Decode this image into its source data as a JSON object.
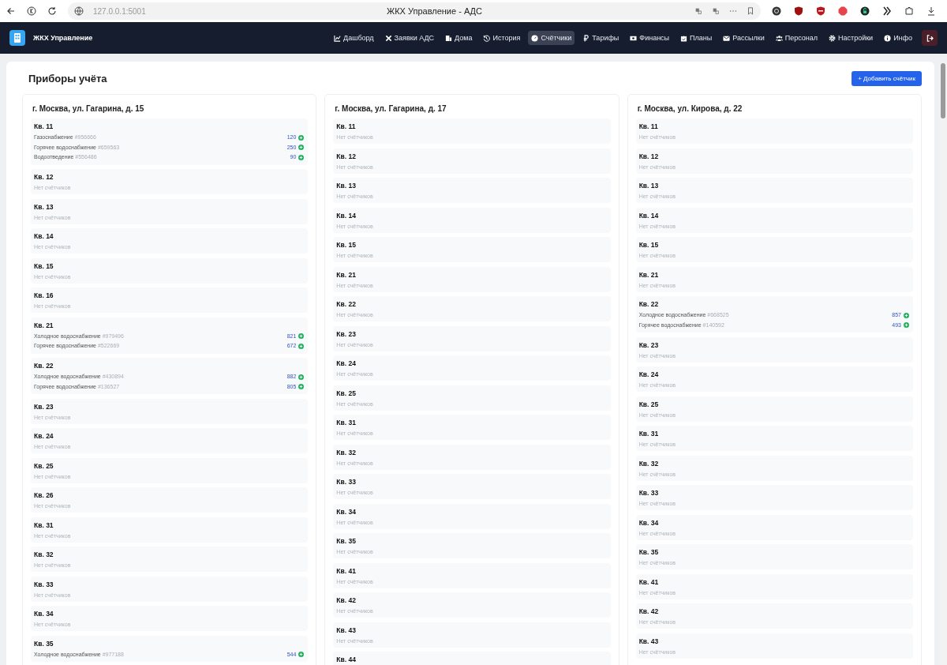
{
  "browser": {
    "url": "127.0.0.1:5001",
    "title": "ЖКХ Управление - АДС"
  },
  "app": {
    "brand": "ЖКХ Управление",
    "nav": [
      {
        "label": "Дашборд",
        "selected": false
      },
      {
        "label": "Заявки АДС",
        "selected": false
      },
      {
        "label": "Дома",
        "selected": false
      },
      {
        "label": "История",
        "selected": false
      },
      {
        "label": "Счётчики",
        "selected": true
      },
      {
        "label": "Тарифы",
        "selected": false
      },
      {
        "label": "Финансы",
        "selected": false
      },
      {
        "label": "Планы",
        "selected": false
      },
      {
        "label": "Рассылки",
        "selected": false
      },
      {
        "label": "Персонал",
        "selected": false
      },
      {
        "label": "Настройки",
        "selected": false
      },
      {
        "label": "Инфо",
        "selected": false
      }
    ]
  },
  "page": {
    "title": "Приборы учёта",
    "add_button": "+ Добавить счётчик"
  },
  "houses": [
    {
      "address": "г. Москва, ул. Гагарина, д. 15",
      "apartments": [
        {
          "name": "Кв. 11",
          "meters": [
            {
              "type": "Газоснабжение",
              "number": "#956666",
              "reading": "120"
            },
            {
              "type": "Горячее водоснабжение",
              "number": "#659563",
              "reading": "250"
            },
            {
              "type": "Водоотведение",
              "number": "#556486",
              "reading": "90"
            }
          ]
        },
        {
          "name": "Кв. 12",
          "note": "Нет счётчиков"
        },
        {
          "name": "Кв. 13",
          "note": "Нет счётчиков"
        },
        {
          "name": "Кв. 14",
          "note": "Нет счётчиков"
        },
        {
          "name": "Кв. 15",
          "note": "Нет счётчиков"
        },
        {
          "name": "Кв. 16",
          "note": "Нет счётчиков"
        },
        {
          "name": "Кв. 21",
          "meters": [
            {
              "type": "Холодное водоснабжение",
              "number": "#979496",
              "reading": "821"
            },
            {
              "type": "Горячее водоснабжение",
              "number": "#522669",
              "reading": "672"
            }
          ]
        },
        {
          "name": "Кв. 22",
          "meters": [
            {
              "type": "Холодное водоснабжение",
              "number": "#430894",
              "reading": "882"
            },
            {
              "type": "Горячее водоснабжение",
              "number": "#136527",
              "reading": "805"
            }
          ]
        },
        {
          "name": "Кв. 23",
          "note": "Нет счётчиков"
        },
        {
          "name": "Кв. 24",
          "note": "Нет счётчиков"
        },
        {
          "name": "Кв. 25",
          "note": "Нет счётчиков"
        },
        {
          "name": "Кв. 26",
          "note": "Нет счётчиков"
        },
        {
          "name": "Кв. 31",
          "note": "Нет счётчиков"
        },
        {
          "name": "Кв. 32",
          "note": "Нет счётчиков"
        },
        {
          "name": "Кв. 33",
          "note": "Нет счётчиков"
        },
        {
          "name": "Кв. 34",
          "note": "Нет счётчиков"
        },
        {
          "name": "Кв. 35",
          "meters": [
            {
              "type": "Холодное водоснабжение",
              "number": "#977188",
              "reading": "544"
            }
          ]
        }
      ]
    },
    {
      "address": "г. Москва, ул. Гагарина, д. 17",
      "apartments": [
        {
          "name": "Кв. 11",
          "note": "Нет счётчиков"
        },
        {
          "name": "Кв. 12",
          "note": "Нет счётчиков"
        },
        {
          "name": "Кв. 13",
          "note": "Нет счётчиков"
        },
        {
          "name": "Кв. 14",
          "note": "Нет счётчиков"
        },
        {
          "name": "Кв. 15",
          "note": "Нет счётчиков"
        },
        {
          "name": "Кв. 21",
          "note": "Нет счётчиков"
        },
        {
          "name": "Кв. 22",
          "note": "Нет счётчиков"
        },
        {
          "name": "Кв. 23",
          "note": "Нет счётчиков"
        },
        {
          "name": "Кв. 24",
          "note": "Нет счётчиков"
        },
        {
          "name": "Кв. 25",
          "note": "Нет счётчиков"
        },
        {
          "name": "Кв. 31",
          "note": "Нет счётчиков"
        },
        {
          "name": "Кв. 32",
          "note": "Нет счётчиков"
        },
        {
          "name": "Кв. 33",
          "note": "Нет счётчиков"
        },
        {
          "name": "Кв. 34",
          "note": "Нет счётчиков"
        },
        {
          "name": "Кв. 35",
          "note": "Нет счётчиков"
        },
        {
          "name": "Кв. 41",
          "note": "Нет счётчиков"
        },
        {
          "name": "Кв. 42",
          "note": "Нет счётчиков"
        },
        {
          "name": "Кв. 43",
          "note": "Нет счётчиков"
        },
        {
          "name": "Кв. 44"
        }
      ]
    },
    {
      "address": "г. Москва, ул. Кирова, д. 22",
      "apartments": [
        {
          "name": "Кв. 11",
          "note": "Нет счётчиков"
        },
        {
          "name": "Кв. 12",
          "note": "Нет счётчиков"
        },
        {
          "name": "Кв. 13",
          "note": "Нет счётчиков"
        },
        {
          "name": "Кв. 14",
          "note": "Нет счётчиков"
        },
        {
          "name": "Кв. 15",
          "note": "Нет счётчиков"
        },
        {
          "name": "Кв. 21",
          "note": "Нет счётчиков"
        },
        {
          "name": "Кв. 22",
          "meters": [
            {
              "type": "Холодное водоснабжение",
              "number": "#668525",
              "reading": "857"
            },
            {
              "type": "Горячее водоснабжение",
              "number": "#140592",
              "reading": "493"
            }
          ]
        },
        {
          "name": "Кв. 23",
          "note": "Нет счётчиков"
        },
        {
          "name": "Кв. 24",
          "note": "Нет счётчиков"
        },
        {
          "name": "Кв. 25",
          "note": "Нет счётчиков"
        },
        {
          "name": "Кв. 31",
          "note": "Нет счётчиков"
        },
        {
          "name": "Кв. 32",
          "note": "Нет счётчиков"
        },
        {
          "name": "Кв. 33",
          "note": "Нет счётчиков"
        },
        {
          "name": "Кв. 34",
          "note": "Нет счётчиков"
        },
        {
          "name": "Кв. 35",
          "note": "Нет счётчиков"
        },
        {
          "name": "Кв. 41",
          "note": "Нет счётчиков"
        },
        {
          "name": "Кв. 42",
          "note": "Нет счётчиков"
        },
        {
          "name": "Кв. 43",
          "note": "Нет счётчиков"
        }
      ]
    }
  ]
}
